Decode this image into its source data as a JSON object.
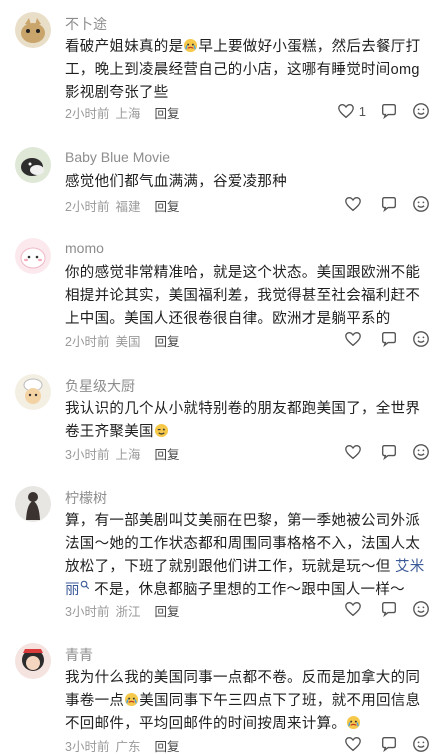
{
  "comments": [
    {
      "name": "不卜途",
      "body_a": "看破产姐妹真的是",
      "body_b": "早上要做好小蛋糕，然后去餐厅打工，晚上到凌晨经营自己的小店，这哪有睡觉时间omg影视剧夸张了些",
      "time": "2小时前",
      "location": "上海",
      "reply": "回复",
      "likes": "1"
    },
    {
      "name": "Baby Blue Movie",
      "body_a": "感觉他们都气血满满，谷爱凌那种",
      "time": "2小时前",
      "location": "福建",
      "reply": "回复",
      "likes": ""
    },
    {
      "name": "momo",
      "body_a": "你的感觉非常精准哈，就是这个状态。美国跟欧洲不能相提并论其实，美国福利差，我觉得甚至社会福利赶不上中国。美国人还很卷很自律。欧洲才是躺平系的",
      "time": "2小时前",
      "location": "美国",
      "reply": "回复",
      "likes": ""
    },
    {
      "name": "负星级大厨",
      "body_a": "我认识的几个从小就特别卷的朋友都跑美国了，全世界卷王齐聚美国",
      "time": "3小时前",
      "location": "上海",
      "reply": "回复",
      "likes": ""
    },
    {
      "name": "柠檬树",
      "body_a": "算，有一部美剧叫艾美丽在巴黎，第一季她被公司外派法国～她的工作状态都和周围同事格格不入，法国人太放松了，下班了就别跟他们讲工作，玩就是玩～但 ",
      "body_link": "艾米丽",
      "body_b": " 不是，休息都脑子里想的工作～跟中国人一样～",
      "time": "3小时前",
      "location": "浙江",
      "reply": "回复",
      "likes": ""
    },
    {
      "name": "青青",
      "body_a": "我为什么我的美国同事一点都不卷。反而是加拿大的同事卷一点",
      "body_b": "美国同事下午三四点下了班，就不用回信息不回邮件，平均回邮件的时间按周来计算。",
      "time": "3小时前",
      "location": "广东",
      "reply": "回复",
      "likes": ""
    }
  ],
  "colors": {
    "name": "#8d8d8d",
    "meta": "#9a9a9a",
    "text": "#1f1f1f",
    "link": "#3b5998"
  },
  "icons": [
    "heart-icon",
    "comment-icon",
    "smile-icon",
    "crying-emoji",
    "wink-emoji",
    "search-icon"
  ]
}
